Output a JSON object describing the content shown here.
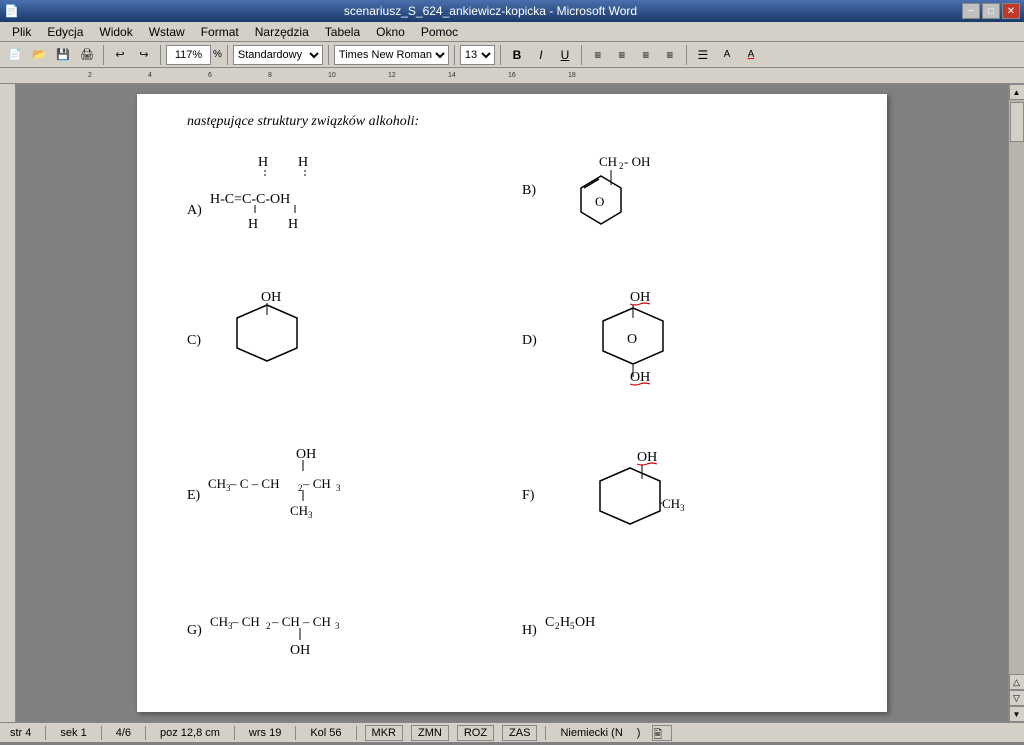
{
  "titleBar": {
    "title": "scenariusz_S_624_ankiewicz-kopicka - Microsoft Word",
    "minBtn": "−",
    "maxBtn": "□",
    "closeBtn": "✕"
  },
  "menuBar": {
    "items": [
      "Plik",
      "Edycja",
      "Widok",
      "Wstaw",
      "Format",
      "Narzędzia",
      "Tabela",
      "Okno",
      "Pomoc"
    ]
  },
  "toolbar": {
    "zoom": "117%",
    "style": "Standardowy",
    "font": "Times New Roman",
    "size": "13"
  },
  "formatBar": {
    "bold": "B",
    "italic": "I",
    "underline": "U"
  },
  "pageTitle": "następujące struktury związków alkoholi:",
  "molecules": {
    "A": {
      "label": "A)",
      "formula": "H-C=C-C-OH"
    },
    "B": {
      "label": "B)",
      "description": "Cyclohexene ring with CH2-OH substituent"
    },
    "C": {
      "label": "C)",
      "description": "Cyclohexane ring with OH substituent"
    },
    "D": {
      "label": "D)",
      "description": "Oxane ring with two OH substituents"
    },
    "E": {
      "label": "E)",
      "formula": "CH3-C-CH2-CH3 with OH and CH3 substituents"
    },
    "F": {
      "label": "F)",
      "description": "Cyclohexane ring with OH and CH3 substituents"
    },
    "G": {
      "label": "G)",
      "formula": "CH3-CH2-CH-CH3 with OH substituent"
    },
    "H": {
      "label": "H)",
      "formula": "C2H5OH"
    }
  },
  "statusBar": {
    "str": "str 4",
    "sek": "sek 1",
    "page": "4/6",
    "pos": "poz 12,8 cm",
    "wrs": "wrs 19",
    "kol": "Kol 56",
    "mkr": "MKR",
    "zmn": "ZMN",
    "roz": "ROZ",
    "zas": "ZAS",
    "lang": "Niemiecki (N"
  },
  "colors": {
    "titleBarStart": "#4a6fad",
    "titleBarEnd": "#1a3a6a",
    "toolbar": "#d4d0c8",
    "docBg": "#808080",
    "pageBg": "#ffffff",
    "redWavy": "#cc0000"
  }
}
